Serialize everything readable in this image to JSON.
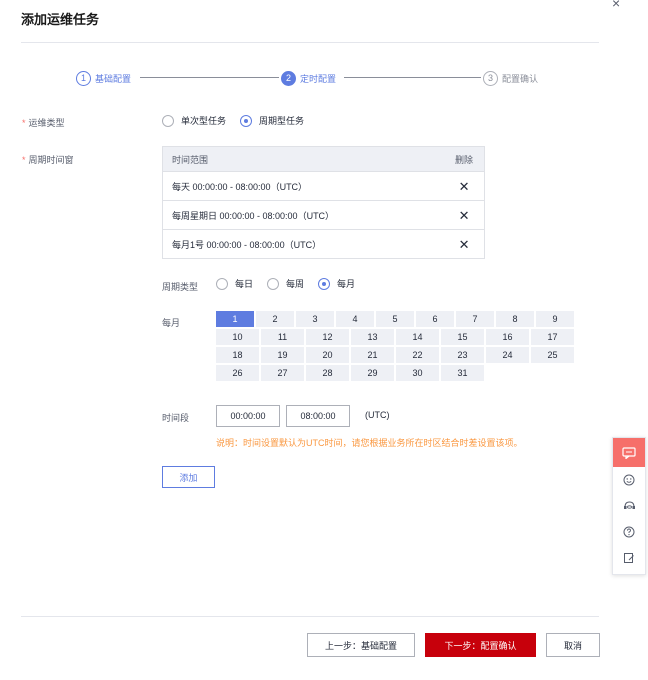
{
  "dialog": {
    "title": "添加运维任务",
    "close_symbol": "×"
  },
  "steps": [
    {
      "number": "1",
      "label": "基础配置",
      "state": "done"
    },
    {
      "number": "2",
      "label": "定时配置",
      "state": "active"
    },
    {
      "number": "3",
      "label": "配置确认",
      "state": "todo"
    }
  ],
  "form": {
    "required_mark": "*",
    "task_type": {
      "label": "运维类型",
      "options": [
        {
          "label": "单次型任务",
          "checked": false
        },
        {
          "label": "周期型任务",
          "checked": true
        }
      ]
    },
    "window": {
      "label": "周期时间窗",
      "table": {
        "headers": {
          "range": "时间范围",
          "delete": "删除"
        },
        "delete_symbol": "✕",
        "rows": [
          {
            "range": "每天 00:00:00 - 08:00:00（UTC）"
          },
          {
            "range": "每周星期日 00:00:00 - 08:00:00（UTC）"
          },
          {
            "range": "每月1号 00:00:00 - 08:00:00（UTC）"
          }
        ]
      }
    },
    "cycle_type": {
      "label": "周期类型",
      "options": [
        {
          "label": "每日",
          "checked": false
        },
        {
          "label": "每周",
          "checked": false
        },
        {
          "label": "每月",
          "checked": true
        }
      ]
    },
    "monthly": {
      "label": "每月",
      "days_row1": [
        "1",
        "2",
        "3",
        "4",
        "5",
        "6",
        "7",
        "8",
        "9"
      ],
      "days_rest": [
        "10",
        "11",
        "12",
        "13",
        "14",
        "15",
        "16",
        "17",
        "18",
        "19",
        "20",
        "21",
        "22",
        "23",
        "24",
        "25",
        "26",
        "27",
        "28",
        "29",
        "30",
        "31"
      ],
      "selected_day": "1"
    },
    "time_period": {
      "label": "时间段",
      "start": "00:00:00",
      "end": "08:00:00",
      "unit": "(UTC)",
      "note": "说明：时间设置默认为UTC时间，请您根据业务所在时区结合时差设置该项。"
    },
    "add_label": "添加"
  },
  "footer": {
    "prev_label": "上一步：基础配置",
    "next_label": "下一步：配置确认",
    "cancel_label": "取消"
  },
  "side_toolbar": {
    "icons": [
      "feedback-icon",
      "smiley-icon",
      "support-icon",
      "help-icon",
      "edit-icon"
    ]
  },
  "colors": {
    "accent": "#5e7ce0",
    "primary_button": "#c7000b",
    "warning_text": "#fa9841",
    "required": "#f66f6a"
  }
}
